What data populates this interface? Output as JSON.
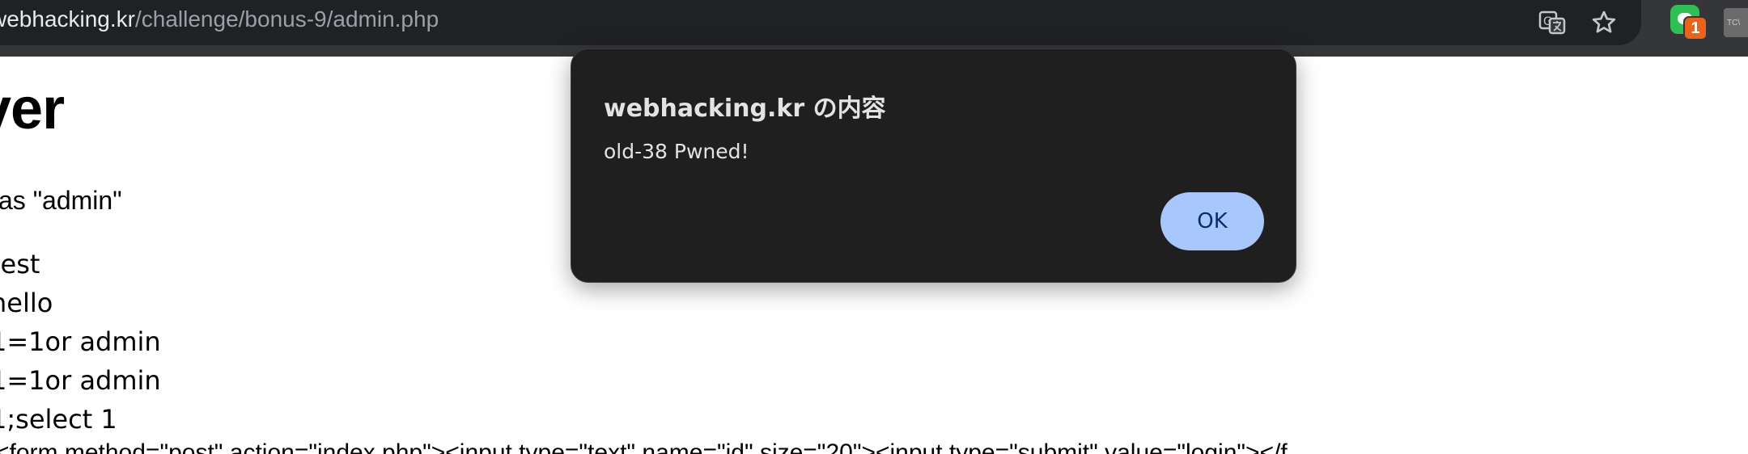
{
  "browser": {
    "url_host": "webhacking.kr",
    "url_path": "/challenge/bonus-9/admin.php",
    "extension_badge_count": "1",
    "extension2_label": "TC\\"
  },
  "page": {
    "title": "ver",
    "hint": "as \"admin\"",
    "log_lines": [
      "test",
      "hello",
      "1=1or admin",
      "1=1or admin",
      "1;select 1"
    ],
    "source_fragment": "<form method=\"post\" action=\"index.php\"><input type=\"text\" name=\"id\" size=\"20\"><input type=\"submit\" value=\"login\"></f"
  },
  "dialog": {
    "title": "webhacking.kr の内容",
    "message": "old-38 Pwned!",
    "ok_label": "OK"
  },
  "colors": {
    "toolbar": "#35363a",
    "omnibox": "#202124",
    "dialog_bg": "#1f1f1f",
    "ok_button": "#a8c7fa"
  }
}
